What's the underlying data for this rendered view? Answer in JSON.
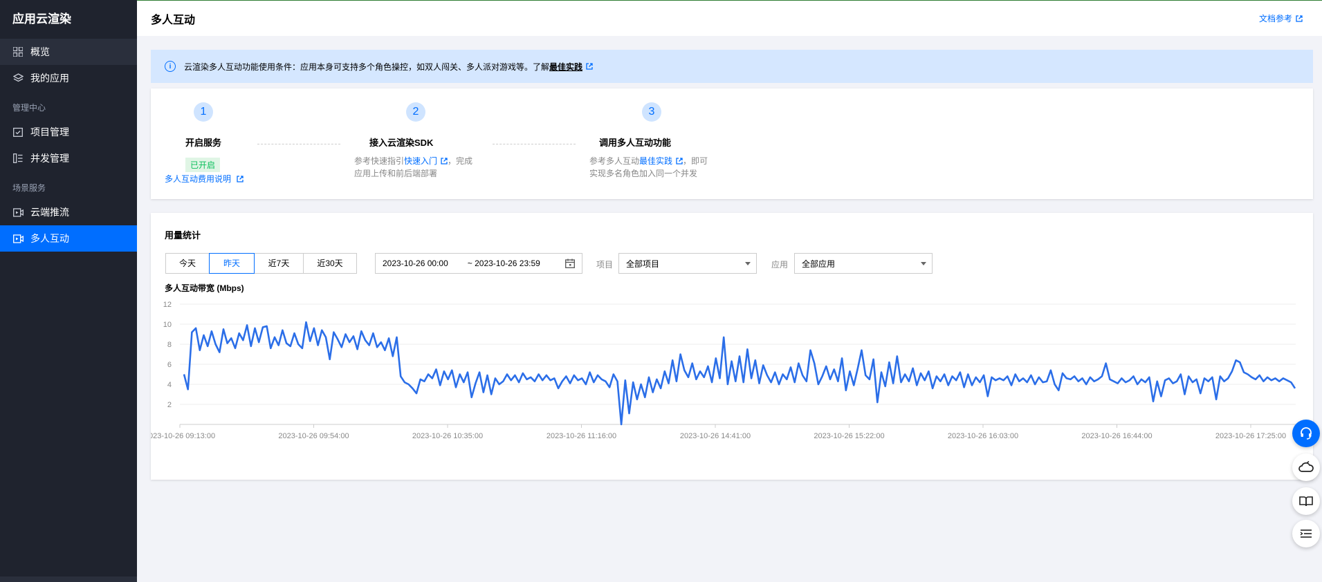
{
  "sidebar": {
    "brand": "应用云渲染",
    "items": [
      {
        "label": "概览",
        "icon": "grid-icon"
      },
      {
        "label": "我的应用",
        "icon": "layers-icon"
      }
    ],
    "group_manage": "管理中心",
    "manage_items": [
      {
        "label": "项目管理",
        "icon": "calendar-check-icon"
      },
      {
        "label": "并发管理",
        "icon": "list-icon"
      }
    ],
    "group_scene": "场景服务",
    "scene_items": [
      {
        "label": "云端推流",
        "icon": "video-icon"
      },
      {
        "label": "多人互动",
        "icon": "video-play-icon"
      }
    ]
  },
  "header": {
    "title": "多人互动",
    "doc_link": "文档参考"
  },
  "notice": {
    "text": "云渲染多人互动功能使用条件：应用本身可支持多个角色操控，如双人闯关、多人派对游戏等。了解",
    "link": "最佳实践"
  },
  "steps": [
    {
      "num": "1",
      "title": "开启服务",
      "badge": "已开启",
      "link": "多人互动费用说明"
    },
    {
      "num": "2",
      "title": "接入云渲染SDK",
      "desc_pre": "参考快速指引",
      "desc_link": "快速入门",
      "desc_post": "，完成",
      "desc_line2": "应用上传和前后端部署"
    },
    {
      "num": "3",
      "title": "调用多人互动功能",
      "desc_pre": "参考多人互动",
      "desc_link": "最佳实践",
      "desc_post": "，即可",
      "desc_line2": "实现多名角色加入同一个并发"
    }
  ],
  "stats": {
    "title": "用量统计",
    "ranges": [
      "今天",
      "昨天",
      "近7天",
      "近30天"
    ],
    "selected_range": "昨天",
    "date_start": "2023-10-26 00:00",
    "date_end": "~ 2023-10-26 23:59",
    "project_label": "项目",
    "project_value": "全部项目",
    "app_label": "应用",
    "app_value": "全部应用",
    "chart_label": "多人互动带宽 (Mbps)"
  },
  "chart_data": {
    "type": "line",
    "title": "多人互动带宽 (Mbps)",
    "ylim": [
      0,
      12
    ],
    "yticks": [
      2,
      4,
      6,
      8,
      10,
      12
    ],
    "xticks": [
      "2023-10-26 09:13:00",
      "2023-10-26 09:54:00",
      "2023-10-26 10:35:00",
      "2023-10-26 11:16:00",
      "2023-10-26 14:41:00",
      "2023-10-26 15:22:00",
      "2023-10-26 16:03:00",
      "2023-10-26 16:44:00",
      "2023-10-26 17:25:00"
    ],
    "grid": true,
    "color": "#2b6ee8",
    "series": [
      {
        "values": [
          5.0,
          3.5,
          9.2,
          9.6,
          7.4,
          8.9,
          7.8,
          9.3,
          8.0,
          7.2,
          9.5,
          8.1,
          8.6,
          7.6,
          9.1,
          8.4,
          9.9,
          7.8,
          9.6,
          8.2,
          9.7,
          9.8,
          7.6,
          8.7,
          7.9,
          9.4,
          8.1,
          7.8,
          9.1,
          8.0,
          7.6,
          10.2,
          8.3,
          9.6,
          7.9,
          9.4,
          8.7,
          6.5,
          9.2,
          8.5,
          7.7,
          9.0,
          8.2,
          8.8,
          7.5,
          9.3,
          8.4,
          7.9,
          9.1,
          7.7,
          8.2,
          7.4,
          8.6,
          6.8,
          8.7,
          4.8,
          4.2,
          4.0,
          3.6,
          3.1,
          4.5,
          4.3,
          5.0,
          4.6,
          5.5,
          3.9,
          5.3,
          4.5,
          5.4,
          3.7,
          5.0,
          4.2,
          5.2,
          2.7,
          4.1,
          5.2,
          3.2,
          4.9,
          3.0,
          4.6,
          4.0,
          4.3,
          5.0,
          4.4,
          4.9,
          4.2,
          5.1,
          4.5,
          4.7,
          4.3,
          5.0,
          4.4,
          4.9,
          4.4,
          4.6,
          3.6,
          4.3,
          4.8,
          4.1,
          4.9,
          4.4,
          4.6,
          4.0,
          5.2,
          4.2,
          4.9,
          4.5,
          4.3,
          3.7,
          5.0,
          4.3,
          0.0,
          4.4,
          1.1,
          4.2,
          2.5,
          4.0,
          2.7,
          4.7,
          3.2,
          4.5,
          3.6,
          5.3,
          4.1,
          6.4,
          4.3,
          7.0,
          5.4,
          4.7,
          6.1,
          4.5,
          5.3,
          4.7,
          5.8,
          4.2,
          6.6,
          4.6,
          8.7,
          4.0,
          6.3,
          4.3,
          6.8,
          4.2,
          7.5,
          4.6,
          6.4,
          4.1,
          5.9,
          4.9,
          4.2,
          5.2,
          4.0,
          5.0,
          4.5,
          5.7,
          4.2,
          6.1,
          4.9,
          4.3,
          7.4,
          6.1,
          4.0,
          4.8,
          5.8,
          4.5,
          5.5,
          4.3,
          6.6,
          3.4,
          5.3,
          3.9,
          5.6,
          7.4,
          4.9,
          4.5,
          6.5,
          2.2,
          5.2,
          3.8,
          6.2,
          4.1,
          6.8,
          4.2,
          5.0,
          4.3,
          5.6,
          3.9,
          5.1,
          4.4,
          5.3,
          3.6,
          4.8,
          4.3,
          5.0,
          3.9,
          4.8,
          4.4,
          5.2,
          3.7,
          5.0,
          3.9,
          4.7,
          4.2,
          4.9,
          2.8,
          4.7,
          4.4,
          4.6,
          4.4,
          4.8,
          3.9,
          5.0,
          4.3,
          4.6,
          4.2,
          4.9,
          4.0,
          4.7,
          4.2,
          4.3,
          5.4,
          4.0,
          3.4,
          5.1,
          4.6,
          4.5,
          4.8,
          4.3,
          4.6,
          4.0,
          4.7,
          4.3,
          4.5,
          4.8,
          6.1,
          4.5,
          4.3,
          4.1,
          4.6,
          4.2,
          4.4,
          4.8,
          4.0,
          4.5,
          4.2,
          4.7,
          2.3,
          4.3,
          2.8,
          4.4,
          4.6,
          4.1,
          4.3,
          5.0,
          3.0,
          4.8,
          4.2,
          4.5,
          3.1,
          4.6,
          4.3,
          4.7,
          2.5,
          4.8,
          4.3,
          4.6,
          5.3,
          6.4,
          6.2,
          5.2,
          5.0,
          4.7,
          4.5,
          4.9,
          4.3,
          4.7,
          4.4,
          4.6,
          4.3,
          4.6,
          4.4,
          4.2,
          3.6
        ]
      }
    ]
  }
}
